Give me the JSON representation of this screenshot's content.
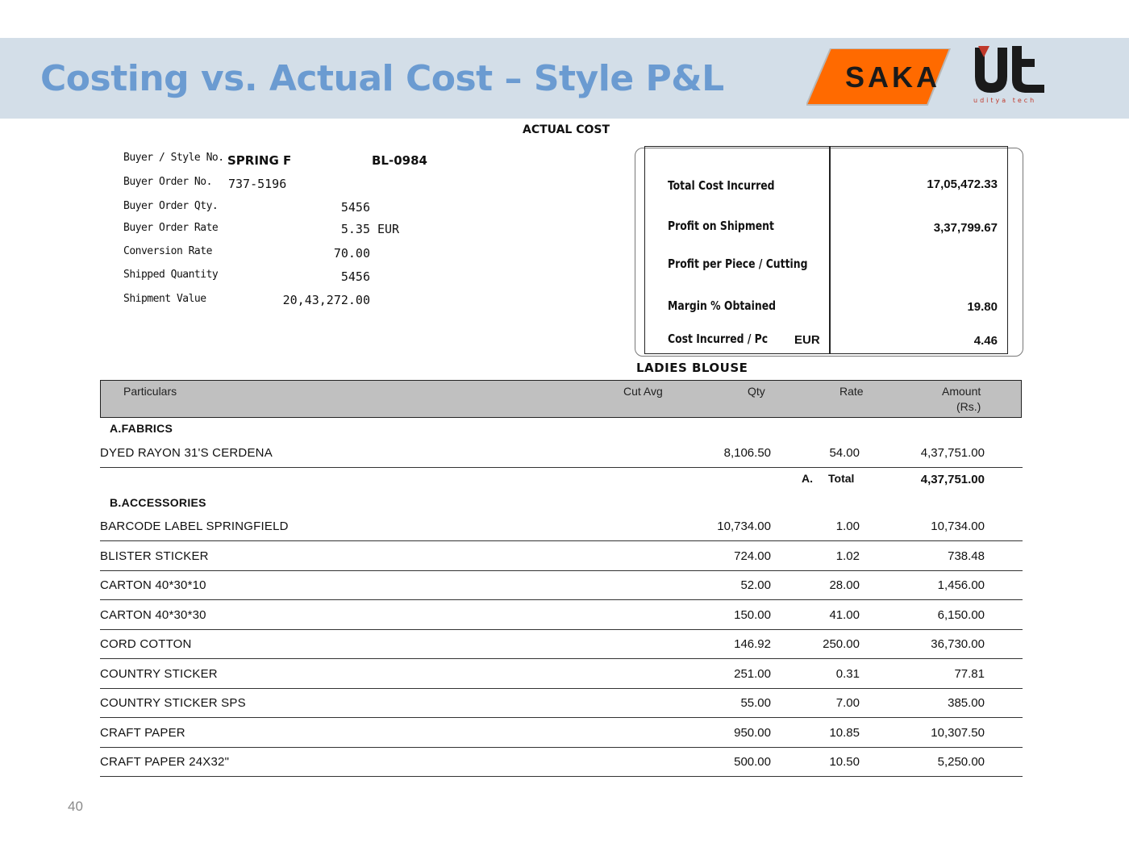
{
  "slide": {
    "title": "Costing vs. Actual Cost – Style P&L",
    "page_number": "40"
  },
  "logos": {
    "saka_text": "SAKA",
    "saka_color": "#ff6600",
    "ut_text": "ut",
    "ut_subtext": "uditya tech"
  },
  "report": {
    "heading": "ACTUAL COST",
    "product": "LADIES BLOUSE"
  },
  "order_info": {
    "buyer_style_label": "Buyer / Style No.",
    "buyer": "SPRING F",
    "style_no": "BL-0984",
    "order_no_label": "Buyer Order No.",
    "order_no": "737-5196",
    "order_qty_label": "Buyer Order Qty.",
    "order_qty": "5456",
    "order_rate_label": "Buyer Order Rate",
    "order_rate": "5.35",
    "order_rate_currency": "EUR",
    "conversion_label": "Conversion Rate",
    "conversion_rate": "70.00",
    "shipped_qty_label": "Shipped Quantity",
    "shipped_qty": "5456",
    "shipment_value_label": "Shipment Value",
    "shipment_value": "20,43,272.00"
  },
  "summary": {
    "total_cost_label": "Total Cost Incurred",
    "total_cost": "17,05,472.33",
    "profit_label": "Profit on Shipment",
    "profit": "3,37,799.67",
    "profit_piece_label": "Profit per Piece / Cutting",
    "margin_label": "Margin % Obtained",
    "margin": "19.80",
    "cost_pc_label": "Cost Incurred / Pc",
    "cost_pc_currency": "EUR",
    "cost_pc": "4.46"
  },
  "table": {
    "headers": {
      "particulars": "Particulars",
      "cut_avg": "Cut Avg",
      "qty": "Qty",
      "rate": "Rate",
      "amount": "Amount",
      "amount_unit": "(Rs.)"
    },
    "section_a": "A.FABRICS",
    "fabrics": [
      {
        "name": "DYED RAYON 31'S CERDENA",
        "qty": "8,106.50",
        "rate": "54.00",
        "amount": "4,37,751.00"
      }
    ],
    "total_a_marker": "A.",
    "total_a_label": "Total",
    "total_a_value": "4,37,751.00",
    "section_b": "B.ACCESSORIES",
    "accessories": [
      {
        "name": "BARCODE LABEL SPRINGFIELD",
        "qty": "10,734.00",
        "rate": "1.00",
        "amount": "10,734.00"
      },
      {
        "name": "BLISTER STICKER",
        "qty": "724.00",
        "rate": "1.02",
        "amount": "738.48"
      },
      {
        "name": "CARTON 40*30*10",
        "qty": "52.00",
        "rate": "28.00",
        "amount": "1,456.00"
      },
      {
        "name": "CARTON 40*30*30",
        "qty": "150.00",
        "rate": "41.00",
        "amount": "6,150.00"
      },
      {
        "name": "CORD COTTON",
        "qty": "146.92",
        "rate": "250.00",
        "amount": "36,730.00"
      },
      {
        "name": "COUNTRY STICKER",
        "qty": "251.00",
        "rate": "0.31",
        "amount": "77.81"
      },
      {
        "name": "COUNTRY STICKER SPS",
        "qty": "55.00",
        "rate": "7.00",
        "amount": "385.00"
      },
      {
        "name": "CRAFT PAPER",
        "qty": "950.00",
        "rate": "10.85",
        "amount": "10,307.50"
      },
      {
        "name": "CRAFT PAPER 24X32\"",
        "qty": "500.00",
        "rate": "10.50",
        "amount": "5,250.00"
      }
    ]
  }
}
